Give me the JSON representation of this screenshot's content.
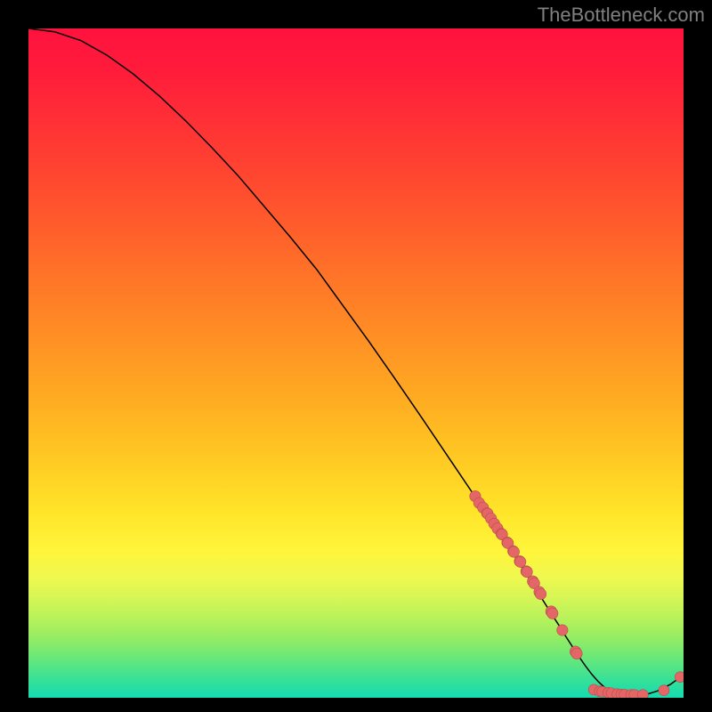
{
  "watermark": "TheBottleneck.com",
  "chart_data": {
    "type": "line",
    "title": "",
    "xlabel": "",
    "ylabel": "",
    "xlim": [
      0,
      100
    ],
    "ylim": [
      0,
      100
    ],
    "curve": {
      "x": [
        0,
        4,
        8,
        12,
        16,
        20,
        24,
        28,
        32,
        36,
        40,
        44,
        48,
        52,
        56,
        60,
        64,
        68,
        72,
        76,
        78,
        80,
        81,
        82,
        83,
        84,
        85,
        86,
        87,
        88,
        90,
        92,
        94,
        96,
        98,
        100
      ],
      "y": [
        100,
        99.5,
        98.2,
        96.0,
        93.2,
        89.9,
        86.2,
        82.2,
        78.0,
        73.4,
        68.8,
        64.0,
        58.6,
        53.2,
        47.6,
        41.9,
        36.1,
        30.3,
        24.4,
        18.5,
        15.4,
        12.3,
        10.8,
        9.2,
        7.7,
        6.2,
        4.8,
        3.5,
        2.4,
        1.5,
        0.7,
        0.4,
        0.4,
        1.0,
        2.0,
        3.4
      ]
    },
    "points_cluster1": {
      "x": [
        68.2,
        68.8,
        69.4,
        70.0,
        70.1,
        70.6,
        71.1,
        71.6,
        72.2,
        72.3,
        73.1,
        73.2,
        74.0,
        74.1,
        75.0,
        75.1,
        76.0,
        76.1,
        77.0,
        77.2,
        78.0,
        78.2,
        79.8,
        80.0,
        81.5,
        83.5,
        83.7
      ],
      "y": [
        30.1,
        29.1,
        28.4,
        27.6,
        27.5,
        26.8,
        26.0,
        25.3,
        24.5,
        24.4,
        23.2,
        23.1,
        21.9,
        21.8,
        20.4,
        20.3,
        18.9,
        18.8,
        17.4,
        17.1,
        15.8,
        15.5,
        12.9,
        12.6,
        10.1,
        6.9,
        6.6
      ]
    },
    "points_cluster2": {
      "x": [
        86.3,
        87.2,
        87.6,
        88.5,
        89.0,
        89.9,
        90.5,
        91.0,
        92.0,
        92.5,
        93.8,
        97.0
      ],
      "y": [
        1.2,
        0.95,
        0.9,
        0.75,
        0.7,
        0.55,
        0.5,
        0.48,
        0.45,
        0.44,
        0.44,
        1.1
      ]
    },
    "point_isolated": {
      "x": 99.5,
      "y": 3.1
    },
    "colors": {
      "curve": "#000000",
      "points": "#e46666",
      "gradient_top": "#ff123e",
      "gradient_bottom": "#14dbb0"
    }
  }
}
